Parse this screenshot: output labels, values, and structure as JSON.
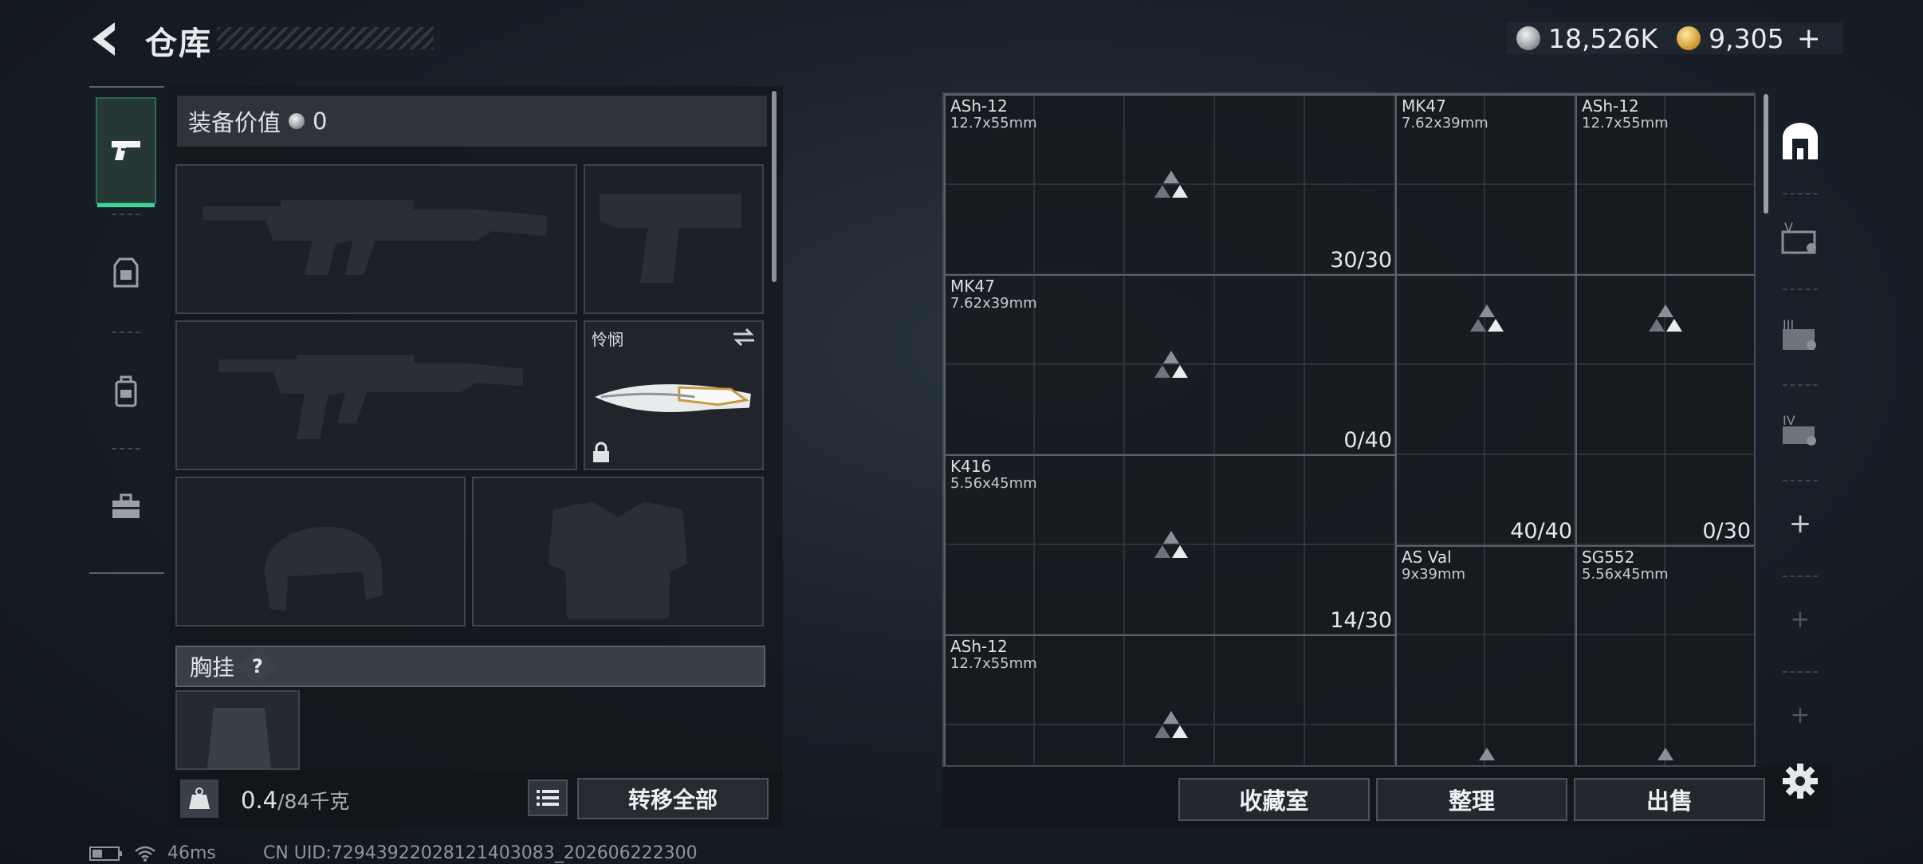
{
  "header": {
    "title": "仓库",
    "currencies": [
      {
        "icon": "silver-coin-icon",
        "value": "18,526K"
      },
      {
        "icon": "gold-coin-icon",
        "value": "9,305"
      }
    ],
    "plus": "+"
  },
  "rail": {
    "items": [
      {
        "name": "weapons",
        "icon": "pistol-icon",
        "active": true
      },
      {
        "name": "armor",
        "icon": "vest-icon",
        "active": false
      },
      {
        "name": "backpack",
        "icon": "backpack-icon",
        "active": false
      },
      {
        "name": "toolbox",
        "icon": "toolbox-icon",
        "active": false
      }
    ]
  },
  "equipment": {
    "value_label": "装备价值",
    "value": "0",
    "knife_name": "怜悯",
    "chest_label": "胸挂",
    "chest_help": "?"
  },
  "footer": {
    "weight_value": "0.4",
    "weight_max": "/84千克",
    "transfer_all": "转移全部",
    "ping": "46ms",
    "uid": "CN UID:7294392202812140308​3_202606222300"
  },
  "storage": {
    "items": [
      {
        "name": "ASh-12",
        "caliber": "12.7x55mm",
        "count": "30/30"
      },
      {
        "name": "MK47",
        "caliber": "7.62x39mm",
        "count": ""
      },
      {
        "name": "ASh-12",
        "caliber": "12.7x55mm",
        "count": ""
      },
      {
        "name": "MK47",
        "caliber": "7.62x39mm",
        "count": "0/40"
      },
      {
        "name": "",
        "caliber": "",
        "count": "40/40"
      },
      {
        "name": "",
        "caliber": "",
        "count": "0/30"
      },
      {
        "name": "K416",
        "caliber": "5.56x45mm",
        "count": "14/30"
      },
      {
        "name": "AS Val",
        "caliber": "9x39mm",
        "count": ""
      },
      {
        "name": "SG552",
        "caliber": "5.56x45mm",
        "count": ""
      },
      {
        "name": "ASh-12",
        "caliber": "12.7x55mm",
        "count": ""
      }
    ],
    "actions": {
      "collection": "收藏室",
      "sort": "整理",
      "sell": "出售"
    }
  },
  "right_rail": {
    "items": [
      {
        "icon": "main-storage-icon"
      },
      {
        "icon": "storage-v-icon",
        "label": "V"
      },
      {
        "icon": "storage-iii-icon",
        "label": "III"
      },
      {
        "icon": "storage-iv-icon",
        "label": "IV"
      },
      {
        "icon": "add-icon",
        "label": "+"
      },
      {
        "icon": "add-icon",
        "label": "+"
      },
      {
        "icon": "add-icon",
        "label": "+"
      }
    ]
  }
}
